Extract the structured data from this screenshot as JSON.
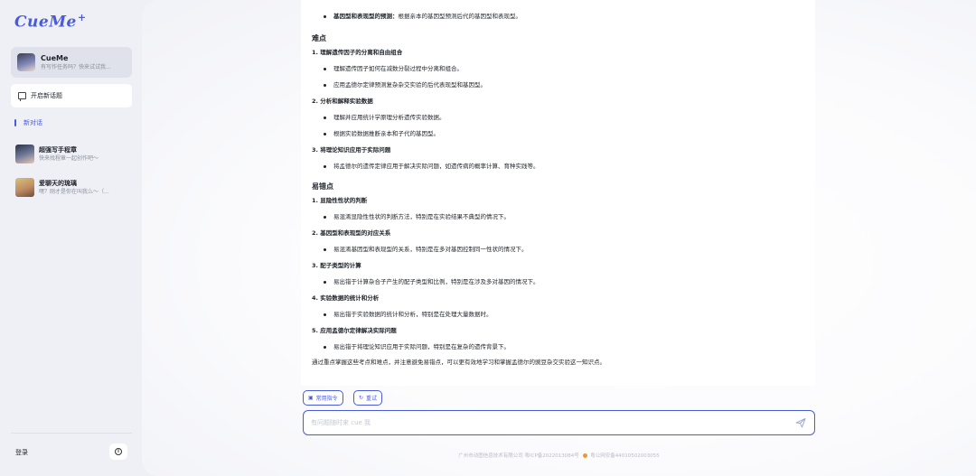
{
  "app": {
    "logo_text": "CueMe",
    "logo_plus": "+"
  },
  "sidebar": {
    "bot": {
      "name": "CueMe",
      "subtitle": "有写作任务吗？快来试试我..."
    },
    "new_topic_label": "开启新话题",
    "active_history_label": "新对话",
    "agents": [
      {
        "name": "超强写手程章",
        "desc": "快来找程章一起创作吧～",
        "icon": "avatar-boy"
      },
      {
        "name": "爱聊天的琉璃",
        "desc": "嘿？刚才是你在叫我么～（...",
        "icon": "avatar-girl"
      }
    ],
    "login_label": "登录",
    "info_label": "i"
  },
  "content": {
    "top_bullet_bold": "基因型和表现型的预测：",
    "top_bullet_rest": "根据亲本的基因型预测后代的基因型和表现型。",
    "difficulty_heading": "难点",
    "difficulty_items": [
      {
        "title": "1. 理解遗传因子的分离和自由组合",
        "bullets": [
          "理解遗传因子如何在减数分裂过程中分离和组合。",
          "应用孟德尔定律预测复杂杂交实验的后代表现型和基因型。"
        ]
      },
      {
        "title": "2. 分析和解释实验数据",
        "bullets": [
          "理解并应用统计学原理分析遗传实验数据。",
          "根据实验数据推断亲本和子代的基因型。"
        ]
      },
      {
        "title": "3. 将理论知识应用于实际问题",
        "bullets": [
          "将孟德尔的遗传定律应用于解决实际问题，如遗传病的概率计算、育种实践等。"
        ]
      }
    ],
    "mistake_heading": "易错点",
    "mistake_items": [
      {
        "title": "1. 显隐性性状的判断",
        "bullets": [
          "易混淆显隐性性状的判断方法，特别是在实验结果不典型的情况下。"
        ]
      },
      {
        "title": "2. 基因型和表现型的对应关系",
        "bullets": [
          "易混淆基因型和表现型的关系，特别是在多对基因控制同一性状的情况下。"
        ]
      },
      {
        "title": "3. 配子类型的计算",
        "bullets": [
          "易出错于计算杂合子产生的配子类型和比例，特别是在涉及多对基因的情况下。"
        ]
      },
      {
        "title": "4. 实验数据的统计和分析",
        "bullets": [
          "易出错于实验数据的统计和分析，特别是在处理大量数据时。"
        ]
      },
      {
        "title": "5. 应用孟德尔定律解决实际问题",
        "bullets": [
          "易出错于将理论知识应用于实际问题，特别是在复杂的遗传背景下。"
        ]
      }
    ],
    "summary": "通过重点掌握这些考点和难点，并注意避免易错点，可以更有效地学习和掌握孟德尔的豌豆杂交实验这一知识点。"
  },
  "actions": {
    "commands_label": "常用指令",
    "retry_label": "重试"
  },
  "input": {
    "placeholder": "有问题随时来 cue 我"
  },
  "footer": {
    "icp": "广州市动图信息技术有限公司 粤ICP备2022013084号",
    "police": "粤公网安备44010502003055"
  },
  "colors": {
    "accent": "#4a5bd8",
    "sidebar_bg": "#eef0f6"
  }
}
